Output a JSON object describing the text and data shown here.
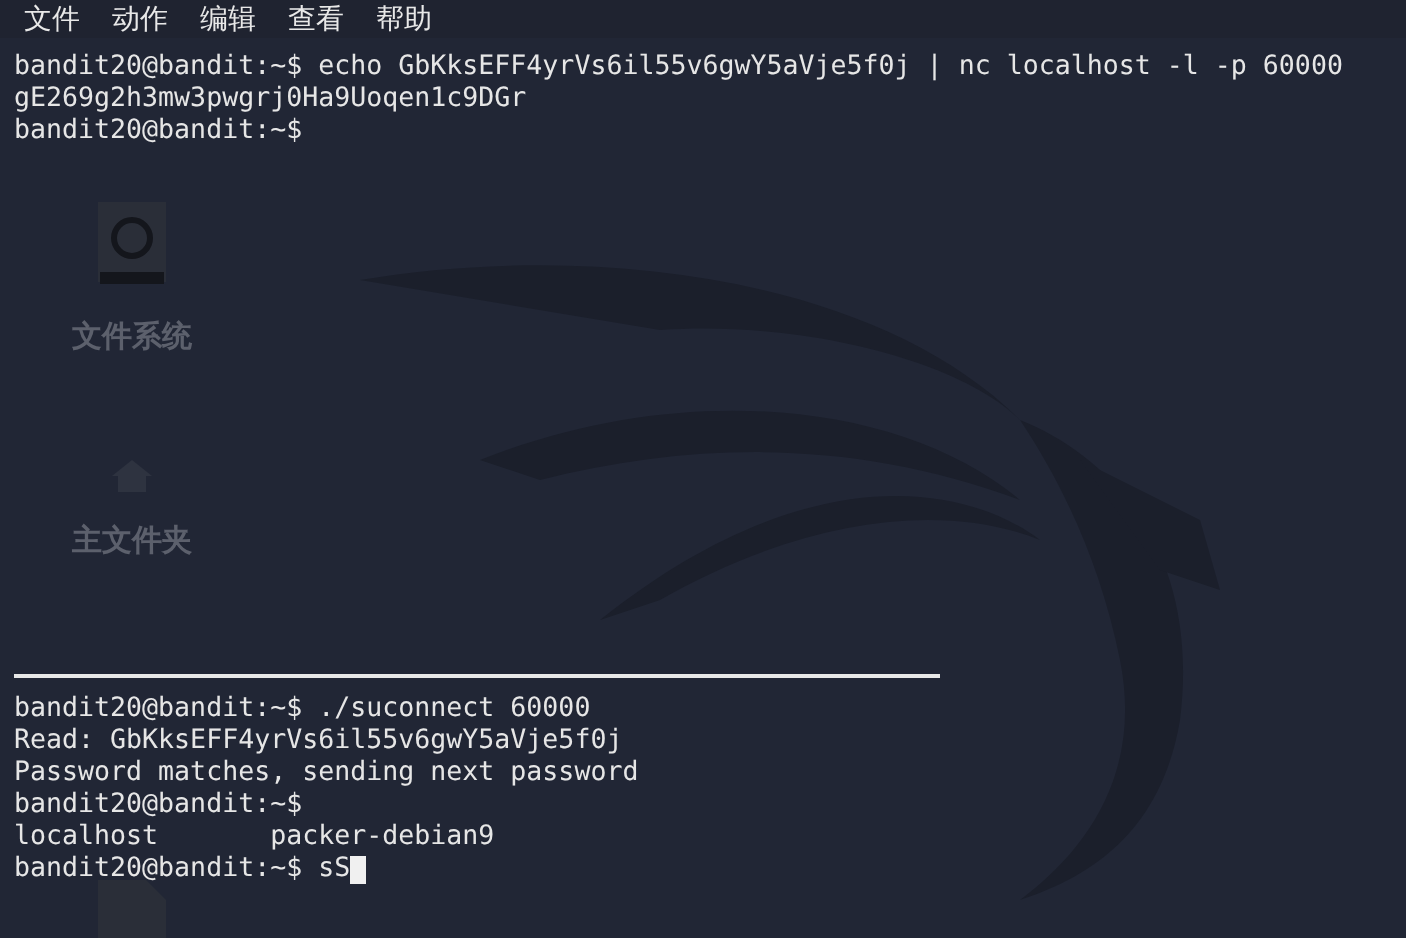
{
  "menu": [
    "文件",
    "动作",
    "编辑",
    "查看",
    "帮助"
  ],
  "desktop_icons": [
    {
      "kind": "drive",
      "label": "文件系统"
    },
    {
      "kind": "home",
      "label": "主文件夹"
    },
    {
      "kind": "file"
    }
  ],
  "panes": [
    {
      "lines": [
        "bandit20@bandit:~$ echo GbKksEFF4yrVs6il55v6gwY5aVje5f0j | nc localhost -l -p 60000",
        "gE269g2h3mw3pwgrj0Ha9Uoqen1c9DGr",
        "bandit20@bandit:~$"
      ],
      "cursor": false
    },
    {
      "lines": [
        "bandit20@bandit:~$ ./suconnect 60000",
        "Read: GbKksEFF4yrVs6il55v6gwY5aVje5f0j",
        "Password matches, sending next password",
        "bandit20@bandit:~$",
        "localhost       packer-debian9",
        "bandit20@bandit:~$ sS"
      ],
      "cursor": true
    }
  ]
}
